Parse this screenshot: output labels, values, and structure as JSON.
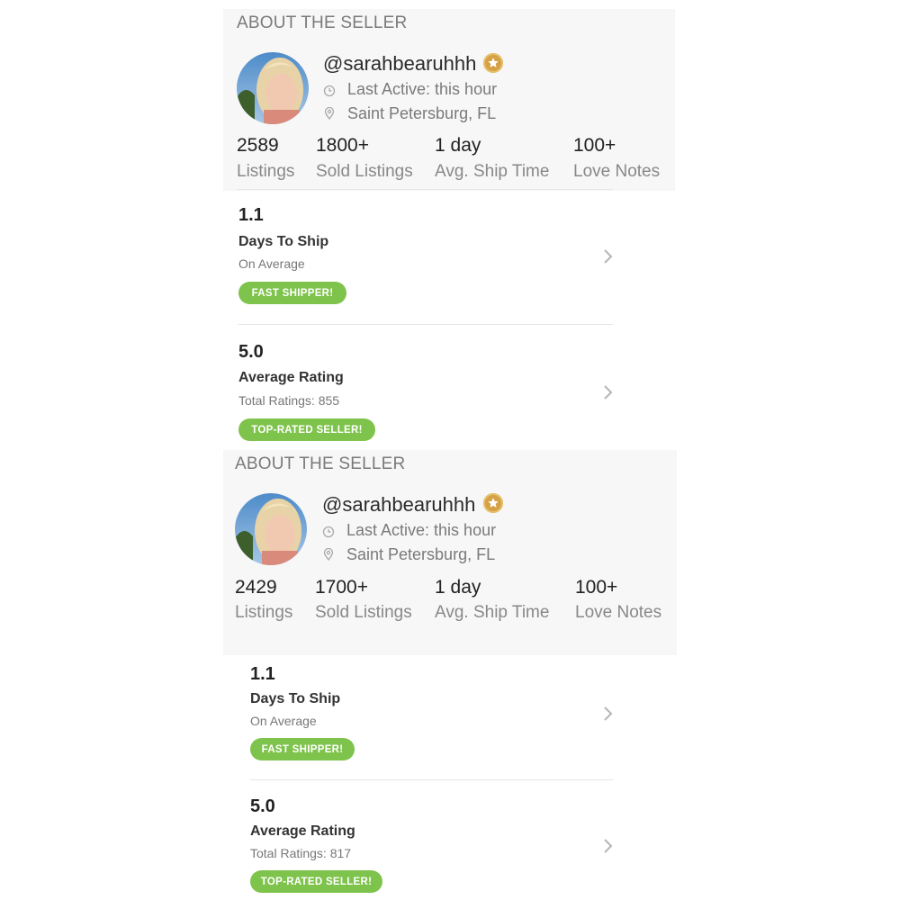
{
  "colors": {
    "panel_bg": "#f7f7f7",
    "pill_green": "#7ec34b",
    "star_gold": "#d5a146",
    "muted_text": "#7a7a7a"
  },
  "icons": {
    "verified": "star-badge-icon",
    "last_active": "clock-icon",
    "location": "location-pin-icon",
    "row_action": "chevron-right-icon"
  },
  "panels": [
    {
      "section_title": "ABOUT THE SELLER",
      "username": "@sarahbearuhhh",
      "last_active": "Last Active: this hour",
      "location": "Saint Petersburg, FL",
      "stats": [
        {
          "value": "2589",
          "label": "Listings"
        },
        {
          "value": "1800+",
          "label": "Sold Listings"
        },
        {
          "value": "1 day",
          "label": "Avg. Ship Time"
        },
        {
          "value": "100+",
          "label": "Love Notes"
        }
      ],
      "metrics": [
        {
          "value": "1.1",
          "title": "Days To Ship",
          "subtitle": "On Average",
          "badge": "FAST SHIPPER!"
        },
        {
          "value": "5.0",
          "title": "Average Rating",
          "subtitle": "Total Ratings: 855",
          "badge": "TOP-RATED SELLER!"
        }
      ]
    },
    {
      "section_title": "ABOUT THE SELLER",
      "username": "@sarahbearuhhh",
      "last_active": "Last Active: this hour",
      "location": "Saint Petersburg, FL",
      "stats": [
        {
          "value": "2429",
          "label": "Listings"
        },
        {
          "value": "1700+",
          "label": "Sold Listings"
        },
        {
          "value": "1 day",
          "label": "Avg. Ship Time"
        },
        {
          "value": "100+",
          "label": "Love Notes"
        }
      ],
      "metrics": [
        {
          "value": "1.1",
          "title": "Days To Ship",
          "subtitle": "On Average",
          "badge": "FAST SHIPPER!"
        },
        {
          "value": "5.0",
          "title": "Average Rating",
          "subtitle": "Total Ratings: 817",
          "badge": "TOP-RATED SELLER!"
        }
      ]
    }
  ]
}
